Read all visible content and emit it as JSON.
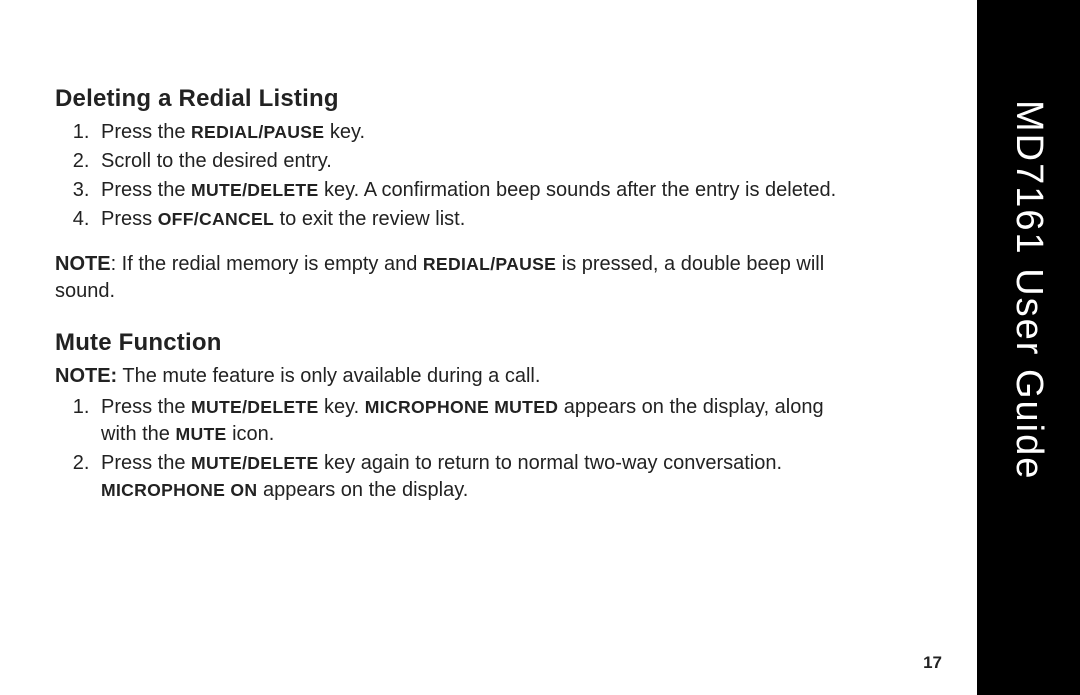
{
  "sidebar": {
    "title": "MD7161 User Guide"
  },
  "section1": {
    "heading": "Deleting a Redial Listing",
    "steps": {
      "s1a": "Press the ",
      "s1k": "REDIAL/PAUSE",
      "s1b": " key.",
      "s2": "Scroll to the desired entry.",
      "s3a": "Press the ",
      "s3k": "MUTE/DELETE",
      "s3b": " key. A confirmation beep sounds after the entry is deleted.",
      "s4a": "Press ",
      "s4k": "OFF/CANCEL",
      "s4b": " to exit the review list."
    },
    "note": {
      "label": "NOTE",
      "a": ": If the redial memory is empty and ",
      "k": "REDIAL/PAUSE",
      "b": " is pressed, a double beep will sound."
    }
  },
  "section2": {
    "heading": "Mute Function",
    "note": {
      "label": "NOTE:",
      "text": " The mute feature is only available during a call."
    },
    "steps": {
      "s1a": "Press the ",
      "s1k1": "MUTE/DELETE",
      "s1b": " key. ",
      "s1k2": "MICROPHONE MUTED",
      "s1c": " appears on the display, along with the ",
      "s1k3": "MUTE",
      "s1d": " icon.",
      "s2a": "Press the ",
      "s2k1": "MUTE/DELETE",
      "s2b": " key again to return to normal two-way conversation. ",
      "s2k2": "MICROPHONE ON",
      "s2c": " appears on the display."
    }
  },
  "page_number": "17"
}
